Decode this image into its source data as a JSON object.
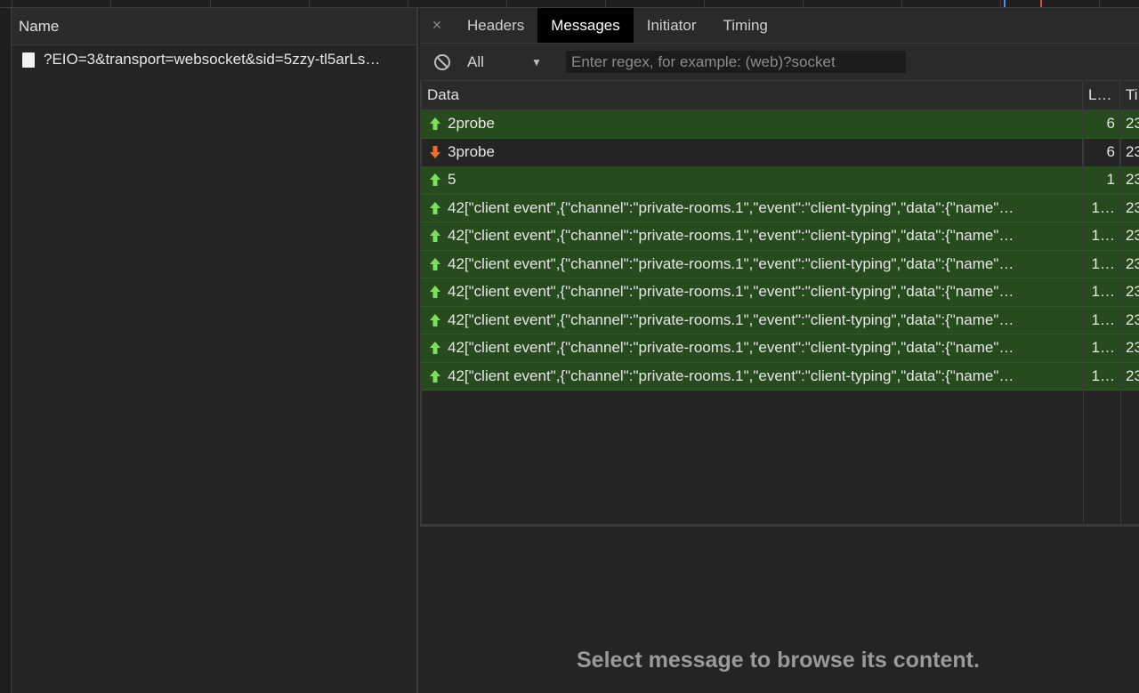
{
  "requests": {
    "header": "Name",
    "items": [
      {
        "name": "?EIO=3&transport=websocket&sid=5zzy-tl5arLs…"
      }
    ]
  },
  "tabs": {
    "close_symbol": "×",
    "items": [
      {
        "label": "Headers",
        "active": false
      },
      {
        "label": "Messages",
        "active": true
      },
      {
        "label": "Initiator",
        "active": false
      },
      {
        "label": "Timing",
        "active": false
      }
    ]
  },
  "filter": {
    "selected": "All",
    "regex_placeholder": "Enter regex, for example: (web)?socket"
  },
  "table": {
    "columns": [
      "Data",
      "L…",
      "Ti"
    ],
    "rows": [
      {
        "direction": "sent",
        "data": "2probe",
        "length": "6",
        "time": "23"
      },
      {
        "direction": "received",
        "data": "3probe",
        "length": "6",
        "time": "23"
      },
      {
        "direction": "sent",
        "data": "5",
        "length": "1",
        "time": "23"
      },
      {
        "direction": "sent",
        "data": "42[\"client event\",{\"channel\":\"private-rooms.1\",\"event\":\"client-typing\",\"data\":{\"name\"…",
        "length": "1…",
        "time": "23"
      },
      {
        "direction": "sent",
        "data": "42[\"client event\",{\"channel\":\"private-rooms.1\",\"event\":\"client-typing\",\"data\":{\"name\"…",
        "length": "1…",
        "time": "23"
      },
      {
        "direction": "sent",
        "data": "42[\"client event\",{\"channel\":\"private-rooms.1\",\"event\":\"client-typing\",\"data\":{\"name\"…",
        "length": "1…",
        "time": "23"
      },
      {
        "direction": "sent",
        "data": "42[\"client event\",{\"channel\":\"private-rooms.1\",\"event\":\"client-typing\",\"data\":{\"name\"…",
        "length": "1…",
        "time": "23"
      },
      {
        "direction": "sent",
        "data": "42[\"client event\",{\"channel\":\"private-rooms.1\",\"event\":\"client-typing\",\"data\":{\"name\"…",
        "length": "1…",
        "time": "23"
      },
      {
        "direction": "sent",
        "data": "42[\"client event\",{\"channel\":\"private-rooms.1\",\"event\":\"client-typing\",\"data\":{\"name\"…",
        "length": "1…",
        "time": "23"
      },
      {
        "direction": "sent",
        "data": "42[\"client event\",{\"channel\":\"private-rooms.1\",\"event\":\"client-typing\",\"data\":{\"name\"…",
        "length": "1…",
        "time": "23"
      }
    ]
  },
  "detail": {
    "placeholder": "Select message to browse its content."
  },
  "colors": {
    "sent_row": "#274b1e",
    "sent_arrow": "#7ee05a",
    "received_arrow": "#f26c2e",
    "timeline_blue": "#4a8ff0",
    "timeline_red": "#e0463a"
  },
  "icons": {
    "close": "close-icon",
    "filter_block": "block-icon",
    "dropdown": "chevron-down-icon",
    "sent": "arrow-up-icon",
    "received": "arrow-down-icon",
    "request": "document-icon"
  }
}
